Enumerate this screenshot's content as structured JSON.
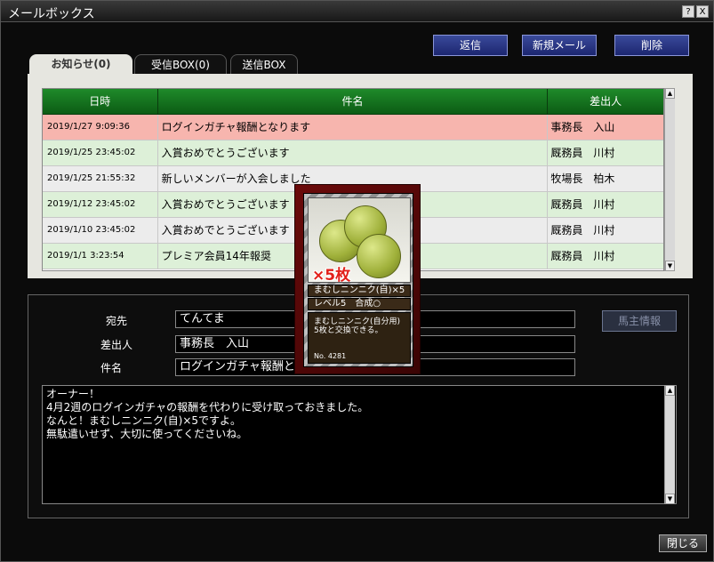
{
  "window": {
    "title": "メールボックス",
    "help_label": "?",
    "close_label": "X"
  },
  "actions": {
    "reply": "返信",
    "new_mail": "新規メール",
    "delete": "削除"
  },
  "tabs": [
    {
      "label": "お知らせ(0)",
      "active": true
    },
    {
      "label": "受信BOX(0)",
      "active": false
    },
    {
      "label": "送信BOX",
      "active": false
    }
  ],
  "table": {
    "headers": {
      "date": "日時",
      "subject": "件名",
      "sender": "差出人"
    },
    "rows": [
      {
        "date": "2019/1/27 9:09:36",
        "subject": "ログインガチャ報酬となります",
        "sender": "事務長　入山",
        "style": "pink"
      },
      {
        "date": "2019/1/25 23:45:02",
        "subject": "入賞おめでとうございます",
        "sender": "厩務員　川村",
        "style": "green"
      },
      {
        "date": "2019/1/25 21:55:32",
        "subject": "新しいメンバーが入会しました",
        "sender": "牧場長　柏木",
        "style": "gray"
      },
      {
        "date": "2019/1/12 23:45:02",
        "subject": "入賞おめでとうございます",
        "sender": "厩務員　川村",
        "style": "green"
      },
      {
        "date": "2019/1/10 23:45:02",
        "subject": "入賞おめでとうございます",
        "sender": "厩務員　川村",
        "style": "gray"
      },
      {
        "date": "2019/1/1 3:23:54",
        "subject": "プレミア会員14年報奨",
        "sender": "厩務員　川村",
        "style": "green"
      }
    ]
  },
  "detail": {
    "to_label": "宛先",
    "to_value": "てんてま",
    "from_label": "差出人",
    "from_value": "事務長　入山",
    "subject_label": "件名",
    "subject_value": "ログインガチャ報酬とな",
    "horse_owner_button": "馬主情報",
    "message_lines": [
      "オーナー！",
      "4月2週のログインガチャの報酬を代わりに受け取っておきました。",
      "なんと！まむしニンニク(自)×5ですよ。",
      "無駄遣いせず、大切に使ってくださいね。"
    ]
  },
  "card": {
    "quantity": "×5枚",
    "name": "まむしニンニク(自)×5",
    "level": "レベル5　合成○",
    "description_lines": [
      "まむしニンニク(自分用)",
      "5枚と交換できる。"
    ],
    "number": "No. 4281",
    "icon": "green-garlic-balls"
  },
  "footer": {
    "close": "閉じる"
  },
  "colors": {
    "header_green": "#1f8a2a",
    "row_pink": "#f7b5ae",
    "row_green": "#ddf0d8",
    "button_blue": "#2a3788"
  }
}
